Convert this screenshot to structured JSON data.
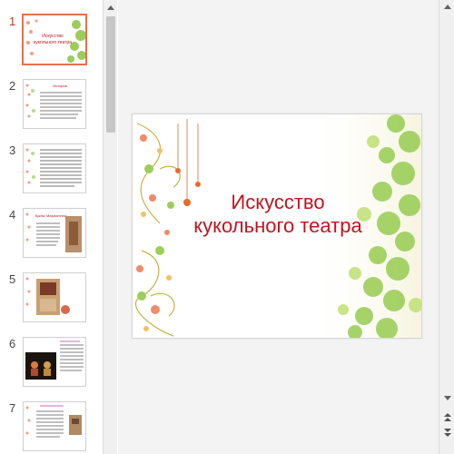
{
  "thumbnails": [
    {
      "number": "1",
      "active": true
    },
    {
      "number": "2",
      "active": false
    },
    {
      "number": "3",
      "active": false
    },
    {
      "number": "4",
      "active": false
    },
    {
      "number": "5",
      "active": false
    },
    {
      "number": "6",
      "active": false
    },
    {
      "number": "7",
      "active": false
    }
  ],
  "slide": {
    "title_line1": "Искусство",
    "title_line2": "кукольного театра"
  },
  "thumb_text": {
    "slide1_title": "Искусство кукольного театра",
    "slide2_title": "История",
    "slide4_title": "Куклы Марионетки"
  },
  "icons": {
    "scroll_up": "chevron-up-icon",
    "scroll_down": "chevron-down-icon",
    "prev_slide": "double-chevron-up-icon",
    "next_slide": "double-chevron-down-icon"
  },
  "colors": {
    "title": "#c0141e",
    "active_border": "#e8704e",
    "active_number": "#c0392b"
  }
}
